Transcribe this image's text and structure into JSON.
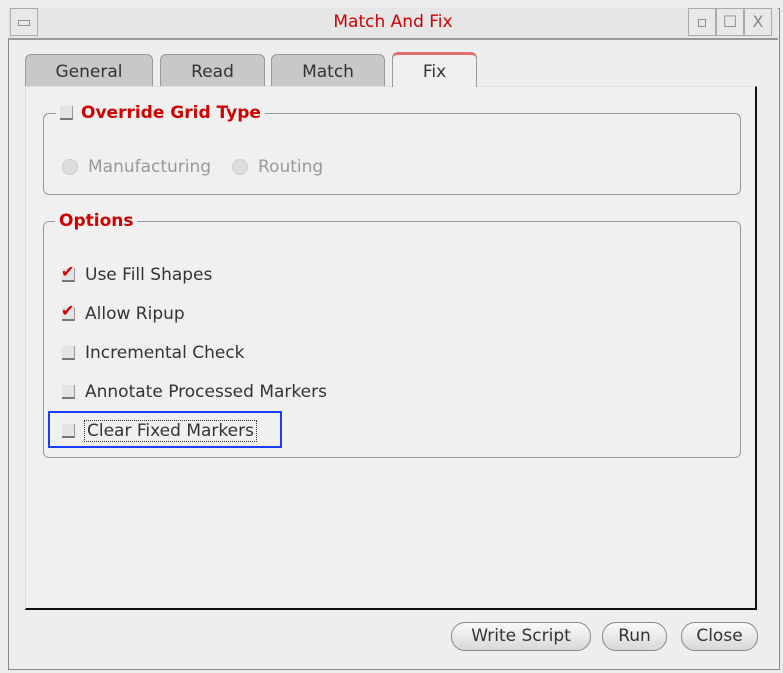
{
  "window": {
    "title": "Match And Fix"
  },
  "tabs": [
    {
      "label": "General"
    },
    {
      "label": "Read"
    },
    {
      "label": "Match"
    },
    {
      "label": "Fix"
    }
  ],
  "active_tab": "Fix",
  "grid_group": {
    "label": "Override Grid Type",
    "checked": false,
    "options": [
      {
        "label": "Manufacturing",
        "selected": true
      },
      {
        "label": "Routing",
        "selected": false
      }
    ]
  },
  "options_group": {
    "label": "Options",
    "items": [
      {
        "label": "Use Fill Shapes",
        "checked": true
      },
      {
        "label": "Allow Ripup",
        "checked": true
      },
      {
        "label": "Incremental Check",
        "checked": false
      },
      {
        "label": "Annotate Processed Markers",
        "checked": false
      },
      {
        "label": "Clear Fixed Markers",
        "checked": false
      }
    ]
  },
  "buttons": {
    "write_script": "Write Script",
    "run": "Run",
    "close": "Close"
  },
  "titlebar_icons": {
    "menu": "▭",
    "minimize": "▫",
    "maximize": "☐",
    "close": "X"
  }
}
